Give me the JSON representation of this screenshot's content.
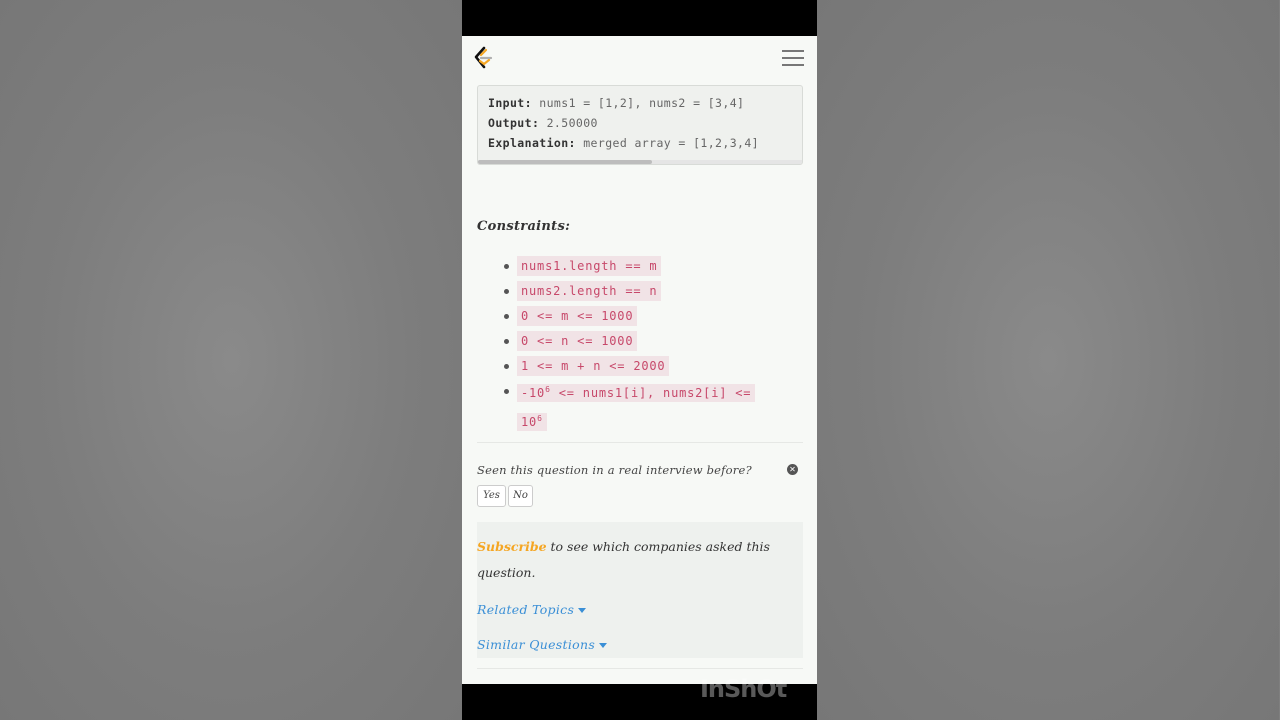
{
  "example": {
    "input_label": "Input:",
    "input_value": "nums1 = [1,2], nums2 = [3,4]",
    "output_label": "Output:",
    "output_value": "2.50000",
    "explanation_label": "Explanation:",
    "explanation_value": "merged array = [1,2,3,4]"
  },
  "constraints": {
    "title": "Constraints:",
    "items": [
      "nums1.length == m",
      "nums2.length == n",
      "0 <= m <= 1000",
      "0 <= n <= 1000",
      "1 <= m + n <= 2000"
    ],
    "last": {
      "part1": "-10",
      "exp1": "6",
      "part2": " <= nums1[i], nums2[i] <= ",
      "part3": "10",
      "exp2": "6"
    }
  },
  "interview": {
    "question": "Seen this question in a real interview before?",
    "close_symbol": "✕",
    "yes_label": "Yes",
    "no_label": "No"
  },
  "subscribe": {
    "link": "Subscribe",
    "text": " to see which companies asked this question."
  },
  "related_topics": "Related Topics",
  "similar_questions": "Similar Questions",
  "watermark": "InShOt"
}
